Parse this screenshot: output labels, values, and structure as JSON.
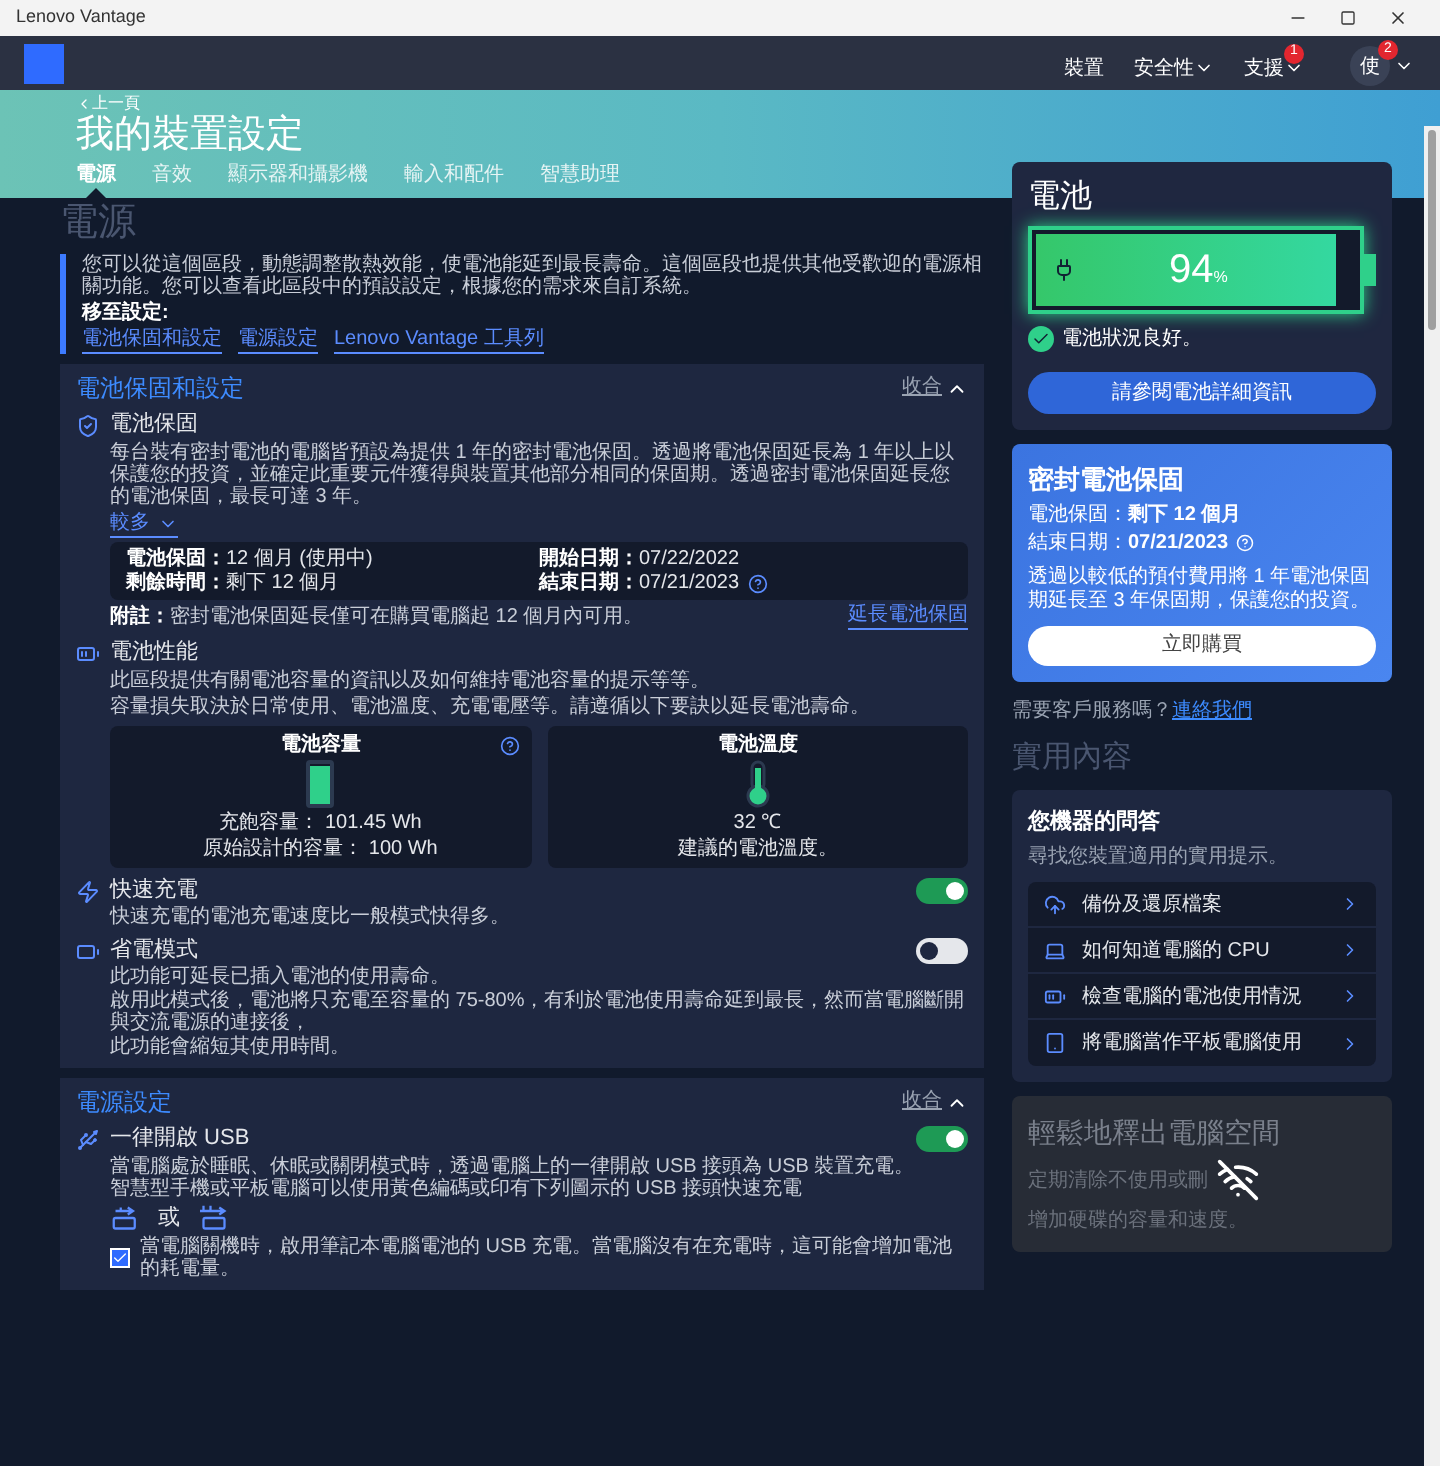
{
  "window": {
    "title": "Lenovo Vantage"
  },
  "top_nav": {
    "items": [
      {
        "label": "裝置",
        "dropdown": false
      },
      {
        "label": "安全性",
        "dropdown": true
      },
      {
        "label": "支援",
        "dropdown": true,
        "badge": "1"
      }
    ],
    "avatar": {
      "initial": "使",
      "badge": "2"
    }
  },
  "hero": {
    "back_link": "上一頁",
    "title": "我的裝置設定",
    "tabs": [
      {
        "label": "電源",
        "selected": true
      },
      {
        "label": "音效",
        "selected": false
      },
      {
        "label": "顯示器和攝影機",
        "selected": false
      },
      {
        "label": "輸入和配件",
        "selected": false
      },
      {
        "label": "智慧助理",
        "selected": false
      }
    ]
  },
  "page": {
    "heading": "電源",
    "intro": "您可以從這個區段，動態調整散熱效能，使電池能延到最長壽命。這個區段也提供其他受歡迎的電源相關功能。您可以查看此區段中的預設設定，根據您的需求來自訂系統。",
    "jump_label": "移至設定:",
    "jump_links": [
      "電池保固和設定",
      "電源設定",
      "Lenovo Vantage 工具列"
    ]
  },
  "sections": [
    {
      "title": "電池保固和設定",
      "collapse": "收合",
      "expanded": true,
      "items": [
        {
          "kind": "warranty",
          "title": "電池保固",
          "desc": "每台裝有密封電池的電腦皆預設為提供 1 年的密封電池保固。透過將電池保固延長為 1 年以上以保護您的投資，並確定此重要元件獲得與裝置其他部分相同的保固期。透過密封電池保固延長您的電池保固，最長可達 3 年。",
          "more": "較多",
          "details": [
            {
              "label": "電池保固：",
              "value": "12 個月 (使用中)"
            },
            {
              "label": "開始日期：",
              "value": "07/22/2022"
            },
            {
              "label": "剩餘時間：",
              "value": "剩下 12 個月"
            },
            {
              "label": "結束日期：",
              "value": "07/21/2023",
              "help": true
            }
          ],
          "note_label": "附註：",
          "note": "密封電池保固延長僅可在購買電腦起 12 個月內可用。",
          "action": "延長電池保固"
        },
        {
          "kind": "performance",
          "title": "電池性能",
          "desc": [
            "此區段提供有關電池容量的資訊以及如何維持電池容量的提示等等。",
            "容量損失取決於日常使用、電池溫度、充電電壓等。請遵循以下要訣以延長電池壽命。"
          ],
          "capacity": {
            "title": "電池容量",
            "level": 0.95,
            "lines": [
              "充飽容量： 101.45 Wh",
              "原始設計的容量： 100 Wh"
            ]
          },
          "temperature": {
            "title": "電池溫度",
            "reading": "32 ℃",
            "note": "建議的電池溫度。"
          }
        },
        {
          "kind": "toggle",
          "title": "快速充電",
          "on": true,
          "desc": [
            "快速充電的電池充電速度比一般模式快得多。"
          ]
        },
        {
          "kind": "toggle",
          "title": "省電模式",
          "on": false,
          "desc": [
            "此功能可延長已插入電池的使用壽命。",
            "啟用此模式後，電池將只充電至容量的 75-80%，有利於電池使用壽命延到最長，然而當電腦斷開與交流電源的連接後，",
            "此功能會縮短其使用時間。"
          ]
        }
      ]
    },
    {
      "title": "電源設定",
      "collapse": "收合",
      "expanded": true,
      "items": [
        {
          "kind": "usb",
          "title": "一律開啟 USB",
          "on": true,
          "desc": "當電腦處於睡眠、休眠或關閉模式時，透過電腦上的一律開啟 USB 接頭為 USB 裝置充電。智慧型手機或平板電腦可以使用黃色編碼或印有下列圖示的 USB 接頭快速充電",
          "or": "或",
          "checkbox": {
            "checked": true,
            "label": "當電腦關機時，啟用筆記本電腦電池的 USB 充電。當電腦沒有在充電時，這可能會增加電池的耗電量。"
          }
        }
      ]
    }
  ],
  "battery_card": {
    "title": "電池",
    "level": 0.94,
    "percent": "94",
    "unit": "%",
    "status": "電池狀況良好。",
    "button": "請參閱電池詳細資訊"
  },
  "warranty_card": {
    "title": "密封電池保固",
    "lines": [
      {
        "label": "電池保固：",
        "value": "剩下 12 個月"
      },
      {
        "label": "結束日期：",
        "value": "07/21/2023",
        "help": true
      }
    ],
    "desc": "透過以較低的預付費用將 1 年電池保固期延長至 3 年保固期，保護您的投資。",
    "button": "立即購買"
  },
  "support": {
    "text": "需要客戶服務嗎？",
    "link": "連絡我們"
  },
  "useful": {
    "heading": "實用內容",
    "qa": {
      "title": "您機器的問答",
      "subtitle": "尋找您裝置適用的實用提示。",
      "items": [
        "備份及還原檔案",
        "如何知道電腦的 CPU",
        "檢查電腦的電池使用情況",
        "將電腦當作平板電腦使用"
      ]
    },
    "promo": {
      "title": "輕鬆地釋出電腦空間",
      "desc": [
        "定期清除不使用或刪",
        "增加硬碟的容量和速度。"
      ]
    }
  }
}
